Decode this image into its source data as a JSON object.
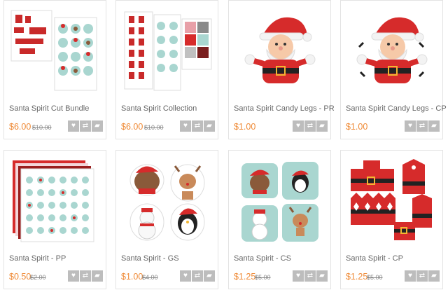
{
  "products": [
    {
      "title": "Santa Spirit Cut Bundle",
      "price": "$6.00",
      "old_price": "$10.00"
    },
    {
      "title": "Santa Spirit Collection",
      "price": "$6.00",
      "old_price": "$10.00"
    },
    {
      "title": "Santa Spirit Candy Legs - PR",
      "price": "$1.00",
      "old_price": ""
    },
    {
      "title": "Santa Spirit Candy Legs - CP",
      "price": "$1.00",
      "old_price": ""
    },
    {
      "title": "Santa Spirit - PP",
      "price": "$0.50",
      "old_price": "$2.00"
    },
    {
      "title": "Santa Spirit - GS",
      "price": "$1.00",
      "old_price": "$4.00"
    },
    {
      "title": "Santa Spirit - CS",
      "price": "$1.25",
      "old_price": "$5.00"
    },
    {
      "title": "Santa Spirit - CP",
      "price": "$1.25",
      "old_price": "$5.00"
    }
  ],
  "actions": {
    "favorite_icon": "heart-icon",
    "compare_icon": "shuffle-icon",
    "cart_icon": "cart-icon"
  },
  "colors": {
    "price": "#ef8a36",
    "button": "#bdbdbd",
    "santa_red": "#d62b2b",
    "mint": "#a9d6d0"
  }
}
